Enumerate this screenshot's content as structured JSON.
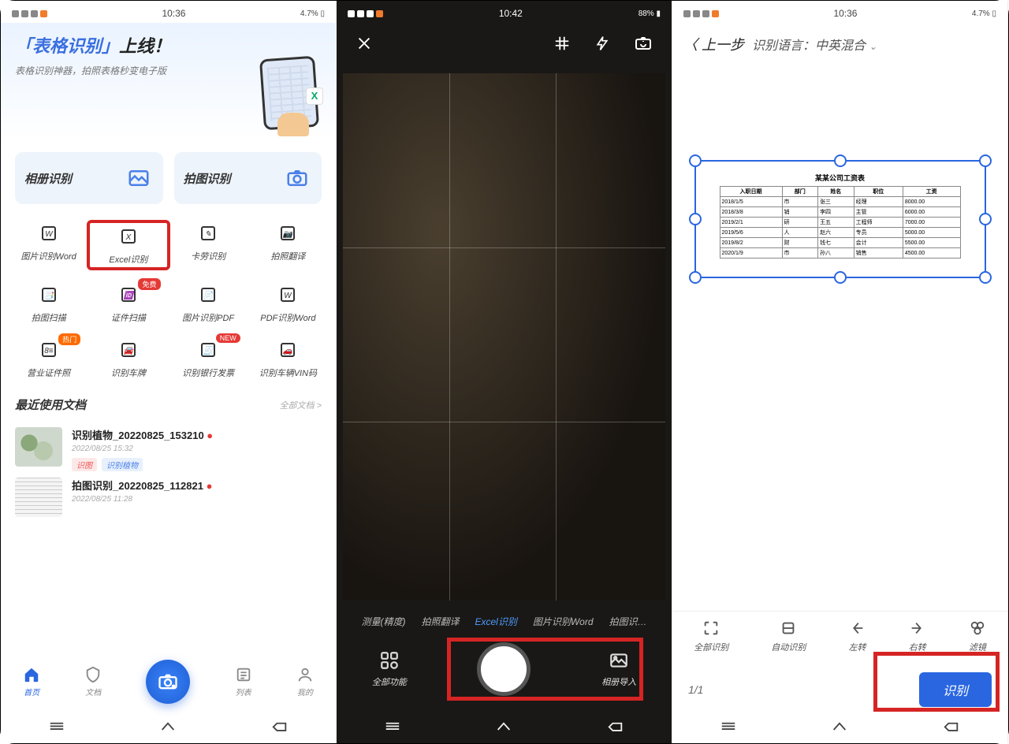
{
  "screen1": {
    "status_time": "10:36",
    "status_right": "4.7% ▯",
    "banner_title_blue": "「表格识别」",
    "banner_title_black": "上线！",
    "banner_sub": "表格识别神器，拍照表格秒变电子版",
    "big_album": "相册识别",
    "big_camera": "拍图识别",
    "tools": [
      {
        "label": "图片识别Word",
        "icon": "W"
      },
      {
        "label": "Excel识别",
        "icon": "X",
        "hl": true
      },
      {
        "label": "卡劳识别",
        "icon": "✎"
      },
      {
        "label": "拍照翻译",
        "icon": "📷"
      },
      {
        "label": "拍图扫描",
        "icon": "📑",
        "badge": ""
      },
      {
        "label": "证件扫描",
        "icon": "🆔",
        "badge": "免费",
        "badgeCls": "r"
      },
      {
        "label": "图片识别PDF",
        "icon": "📄"
      },
      {
        "label": "PDF识别Word",
        "icon": "W"
      },
      {
        "label": "营业证件照",
        "icon": "8≡",
        "badge": "热门",
        "badgeCls": "or"
      },
      {
        "label": "识别车牌",
        "icon": "🚘"
      },
      {
        "label": "识别银行发票",
        "icon": "🧾",
        "badge": "NEW",
        "badgeCls": "r"
      },
      {
        "label": "识别车辆VIN码",
        "icon": "🚗"
      }
    ],
    "recent_hdr": "最近使用文档",
    "recent_more": "全部文档 >",
    "docs": [
      {
        "name": "识别植物_20220825_153210",
        "time": "2022/08/25  15:32",
        "tags": [
          "识图",
          "识别植物"
        ],
        "thumb": "img"
      },
      {
        "name": "拍图识别_20220825_112821",
        "time": "2022/08/25  11:28",
        "thumb": "txt"
      }
    ],
    "nav": [
      {
        "label": "首页",
        "act": true
      },
      {
        "label": "文档"
      },
      {
        "label": "列表"
      },
      {
        "label": "我的"
      }
    ]
  },
  "screen2": {
    "status_time": "10:42",
    "status_right": "88% ▮",
    "modes": [
      "测量(精度)",
      "拍照翻译",
      "Excel识别",
      "图片识别Word",
      "拍图识…"
    ],
    "mode_active": 2,
    "allfn": "全部功能",
    "album": "相册导入"
  },
  "screen3": {
    "status_time": "10:36",
    "status_right": "4.7% ▯",
    "back": "上一步",
    "lang_label": "识别语言：",
    "lang_value": "中英混合",
    "table_title": "某某公司工资表",
    "table_hdr": [
      "入职日期",
      "部门",
      "姓名",
      "职位",
      "工资"
    ],
    "table_rows": [
      [
        "2018/1/5",
        "市",
        "张三",
        "经理",
        "8000.00"
      ],
      [
        "2018/3/8",
        "销",
        "李四",
        "主管",
        "6000.00"
      ],
      [
        "2019/2/1",
        "研",
        "王五",
        "工程师",
        "7000.00"
      ],
      [
        "2019/5/6",
        "人",
        "赵六",
        "专员",
        "5000.00"
      ],
      [
        "2019/8/2",
        "财",
        "钱七",
        "会计",
        "5500.00"
      ],
      [
        "2020/1/9",
        "市",
        "孙八",
        "销售",
        "4500.00"
      ]
    ],
    "tools": [
      "全部识别",
      "自动识别",
      "左转",
      "右转",
      "滤镜"
    ],
    "page": "1/1",
    "recognize": "识别"
  }
}
